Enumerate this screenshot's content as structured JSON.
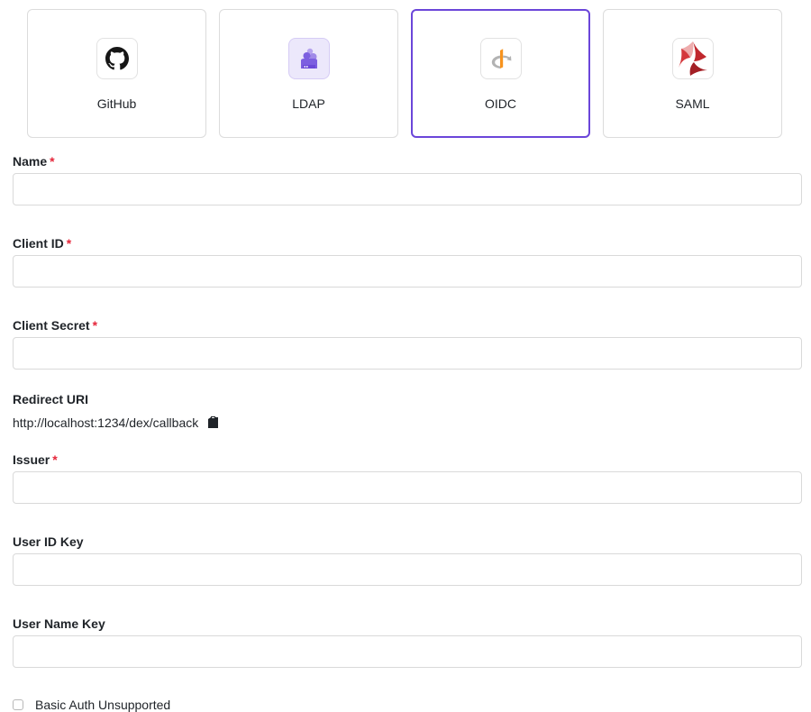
{
  "providers": [
    {
      "label": "GitHub",
      "icon": "github-icon",
      "selected": false
    },
    {
      "label": "LDAP",
      "icon": "ldap-icon",
      "selected": false
    },
    {
      "label": "OIDC",
      "icon": "openid-icon",
      "selected": true
    },
    {
      "label": "SAML",
      "icon": "saml-icon",
      "selected": false
    }
  ],
  "colors": {
    "accent": "#6b46d9",
    "required": "#e5263a",
    "border": "#d9d9d9"
  },
  "form": {
    "required_marker": "*",
    "name": {
      "label": "Name",
      "value": ""
    },
    "client_id": {
      "label": "Client ID",
      "value": ""
    },
    "client_secret": {
      "label": "Client Secret",
      "value": ""
    },
    "redirect_uri": {
      "label": "Redirect URI",
      "value": "http://localhost:1234/dex/callback",
      "icon": "clipboard-icon"
    },
    "issuer": {
      "label": "Issuer",
      "value": ""
    },
    "user_id_key": {
      "label": "User ID Key",
      "value": ""
    },
    "user_name_key": {
      "label": "User Name Key",
      "value": ""
    },
    "basic_auth_unsupported": {
      "label": "Basic Auth Unsupported",
      "checked": false
    }
  }
}
